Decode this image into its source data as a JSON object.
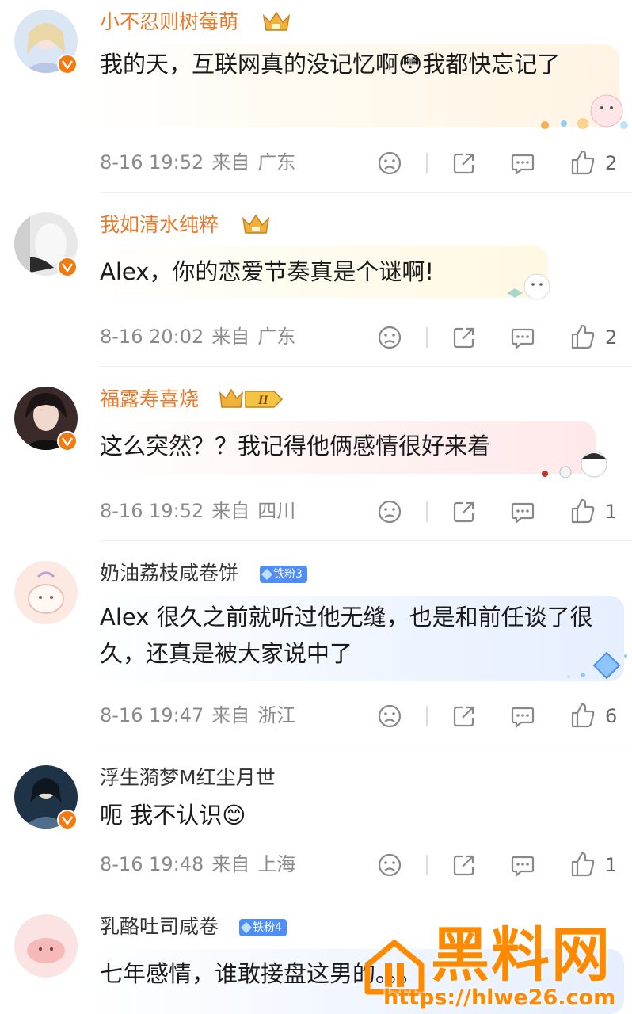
{
  "comments": [
    {
      "username": "小不忍则树莓萌",
      "text": "我的天，互联网真的没记忆啊😳我都快忘记了",
      "date": "8-16 19:52",
      "from": "来自",
      "location": "广东",
      "likes": "2"
    },
    {
      "username": "我如清水纯粹",
      "text": "Alex，你的恋爱节奏真是个谜啊!",
      "date": "8-16 20:02",
      "from": "来自",
      "location": "广东",
      "likes": "2"
    },
    {
      "username": "福露寿喜烧",
      "text": "这么突然？？我记得他俩感情很好来着",
      "date": "8-16 19:52",
      "from": "来自",
      "location": "四川",
      "likes": "1"
    },
    {
      "username": "奶油荔枝咸卷饼",
      "badge": "铁粉3",
      "text": "Alex 很久之前就听过他无缝，也是和前任谈了很久，还真是被大家说中了",
      "date": "8-16 19:47",
      "from": "来自",
      "location": "浙江",
      "likes": "6"
    },
    {
      "username": "浮生漪梦M红尘月世",
      "text": "呃 我不认识😊",
      "date": "8-16 19:48",
      "from": "来自",
      "location": "上海",
      "likes": "1"
    },
    {
      "username": "乳酪吐司咸卷",
      "badge": "铁粉4",
      "text": "七年感情，谁敢接盘这男的。。。"
    }
  ],
  "watermark": {
    "title": "黑料网",
    "url": "https://hlwe26.com"
  },
  "colors": {
    "vip_name": "#e8782a",
    "verified": "#f37a0e",
    "fan_badge": "#4f8ef7",
    "watermark": "#ff8a00",
    "meta": "#8a8a8a"
  },
  "icons": [
    "dislike-icon",
    "share-icon",
    "comment-icon",
    "like-icon",
    "crown-icon",
    "verified-icon",
    "fan-badge-icon"
  ]
}
